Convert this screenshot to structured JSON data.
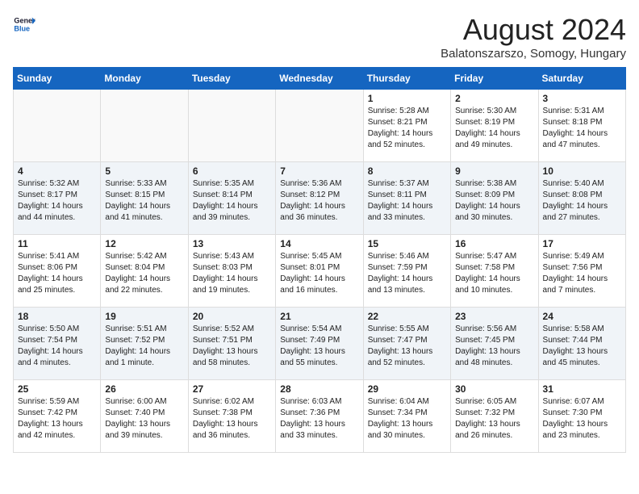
{
  "header": {
    "logo_line1": "General",
    "logo_line2": "Blue",
    "month": "August 2024",
    "location": "Balatonszarszo, Somogy, Hungary"
  },
  "weekdays": [
    "Sunday",
    "Monday",
    "Tuesday",
    "Wednesday",
    "Thursday",
    "Friday",
    "Saturday"
  ],
  "weeks": [
    [
      {
        "day": "",
        "info": ""
      },
      {
        "day": "",
        "info": ""
      },
      {
        "day": "",
        "info": ""
      },
      {
        "day": "",
        "info": ""
      },
      {
        "day": "1",
        "info": "Sunrise: 5:28 AM\nSunset: 8:21 PM\nDaylight: 14 hours\nand 52 minutes."
      },
      {
        "day": "2",
        "info": "Sunrise: 5:30 AM\nSunset: 8:19 PM\nDaylight: 14 hours\nand 49 minutes."
      },
      {
        "day": "3",
        "info": "Sunrise: 5:31 AM\nSunset: 8:18 PM\nDaylight: 14 hours\nand 47 minutes."
      }
    ],
    [
      {
        "day": "4",
        "info": "Sunrise: 5:32 AM\nSunset: 8:17 PM\nDaylight: 14 hours\nand 44 minutes."
      },
      {
        "day": "5",
        "info": "Sunrise: 5:33 AM\nSunset: 8:15 PM\nDaylight: 14 hours\nand 41 minutes."
      },
      {
        "day": "6",
        "info": "Sunrise: 5:35 AM\nSunset: 8:14 PM\nDaylight: 14 hours\nand 39 minutes."
      },
      {
        "day": "7",
        "info": "Sunrise: 5:36 AM\nSunset: 8:12 PM\nDaylight: 14 hours\nand 36 minutes."
      },
      {
        "day": "8",
        "info": "Sunrise: 5:37 AM\nSunset: 8:11 PM\nDaylight: 14 hours\nand 33 minutes."
      },
      {
        "day": "9",
        "info": "Sunrise: 5:38 AM\nSunset: 8:09 PM\nDaylight: 14 hours\nand 30 minutes."
      },
      {
        "day": "10",
        "info": "Sunrise: 5:40 AM\nSunset: 8:08 PM\nDaylight: 14 hours\nand 27 minutes."
      }
    ],
    [
      {
        "day": "11",
        "info": "Sunrise: 5:41 AM\nSunset: 8:06 PM\nDaylight: 14 hours\nand 25 minutes."
      },
      {
        "day": "12",
        "info": "Sunrise: 5:42 AM\nSunset: 8:04 PM\nDaylight: 14 hours\nand 22 minutes."
      },
      {
        "day": "13",
        "info": "Sunrise: 5:43 AM\nSunset: 8:03 PM\nDaylight: 14 hours\nand 19 minutes."
      },
      {
        "day": "14",
        "info": "Sunrise: 5:45 AM\nSunset: 8:01 PM\nDaylight: 14 hours\nand 16 minutes."
      },
      {
        "day": "15",
        "info": "Sunrise: 5:46 AM\nSunset: 7:59 PM\nDaylight: 14 hours\nand 13 minutes."
      },
      {
        "day": "16",
        "info": "Sunrise: 5:47 AM\nSunset: 7:58 PM\nDaylight: 14 hours\nand 10 minutes."
      },
      {
        "day": "17",
        "info": "Sunrise: 5:49 AM\nSunset: 7:56 PM\nDaylight: 14 hours\nand 7 minutes."
      }
    ],
    [
      {
        "day": "18",
        "info": "Sunrise: 5:50 AM\nSunset: 7:54 PM\nDaylight: 14 hours\nand 4 minutes."
      },
      {
        "day": "19",
        "info": "Sunrise: 5:51 AM\nSunset: 7:52 PM\nDaylight: 14 hours\nand 1 minute."
      },
      {
        "day": "20",
        "info": "Sunrise: 5:52 AM\nSunset: 7:51 PM\nDaylight: 13 hours\nand 58 minutes."
      },
      {
        "day": "21",
        "info": "Sunrise: 5:54 AM\nSunset: 7:49 PM\nDaylight: 13 hours\nand 55 minutes."
      },
      {
        "day": "22",
        "info": "Sunrise: 5:55 AM\nSunset: 7:47 PM\nDaylight: 13 hours\nand 52 minutes."
      },
      {
        "day": "23",
        "info": "Sunrise: 5:56 AM\nSunset: 7:45 PM\nDaylight: 13 hours\nand 48 minutes."
      },
      {
        "day": "24",
        "info": "Sunrise: 5:58 AM\nSunset: 7:44 PM\nDaylight: 13 hours\nand 45 minutes."
      }
    ],
    [
      {
        "day": "25",
        "info": "Sunrise: 5:59 AM\nSunset: 7:42 PM\nDaylight: 13 hours\nand 42 minutes."
      },
      {
        "day": "26",
        "info": "Sunrise: 6:00 AM\nSunset: 7:40 PM\nDaylight: 13 hours\nand 39 minutes."
      },
      {
        "day": "27",
        "info": "Sunrise: 6:02 AM\nSunset: 7:38 PM\nDaylight: 13 hours\nand 36 minutes."
      },
      {
        "day": "28",
        "info": "Sunrise: 6:03 AM\nSunset: 7:36 PM\nDaylight: 13 hours\nand 33 minutes."
      },
      {
        "day": "29",
        "info": "Sunrise: 6:04 AM\nSunset: 7:34 PM\nDaylight: 13 hours\nand 30 minutes."
      },
      {
        "day": "30",
        "info": "Sunrise: 6:05 AM\nSunset: 7:32 PM\nDaylight: 13 hours\nand 26 minutes."
      },
      {
        "day": "31",
        "info": "Sunrise: 6:07 AM\nSunset: 7:30 PM\nDaylight: 13 hours\nand 23 minutes."
      }
    ]
  ]
}
